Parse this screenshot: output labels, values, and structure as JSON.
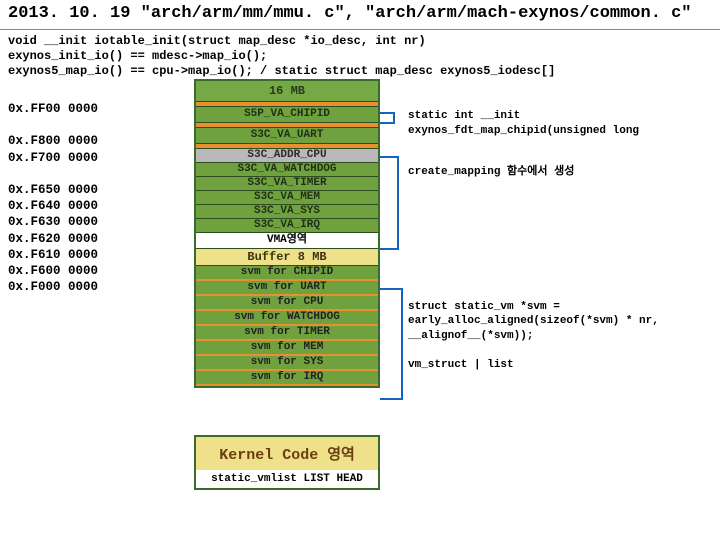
{
  "title": "2013. 10. 19 \"arch/arm/mm/mmu. c\", \"arch/arm/mach-exynos/common. c\"",
  "code": {
    "l1": "void __init iotable_init(struct map_desc *io_desc, int nr)",
    "l2": "exynos_init_io() == mdesc->map_io();",
    "l3": "exynos5_map_io() == cpu->map_io(); / static struct map_desc exynos5_iodesc[]"
  },
  "addresses": [
    "0x.FF00 0000",
    "",
    "0x.F800 0000",
    "0x.F700 0000",
    "",
    "0x.F650 0000",
    "0x.F640 0000",
    "0x.F630 0000",
    "0x.F620 0000",
    "0x.F610 0000",
    "0x.F600 0000",
    "0x.F000 0000"
  ],
  "mem": {
    "header": "16 MB",
    "rows": [
      "S5P_VA_CHIPID",
      "S3C_VA_UART",
      "S3C_ADDR_CPU",
      "S3C_VA_WATCHDOG",
      "S3C_VA_TIMER",
      "S3C_VA_MEM",
      "S3C_VA_SYS",
      "S3C_VA_IRQ"
    ],
    "vma": "VMA영역",
    "buffer": "Buffer 8 MB",
    "svm": [
      "svm for CHIPID",
      "svm for UART",
      "svm for CPU",
      "svm for WATCHDOG",
      "svm for TIMER",
      "svm for MEM",
      "svm for SYS",
      "svm for IRQ"
    ]
  },
  "kernel": {
    "title": "Kernel Code 영역",
    "sub": "static_vmlist LIST HEAD"
  },
  "notes": {
    "n1": "static int __init exynos_fdt_map_chipid(unsigned long",
    "n2": "create_mapping 함수에서 생성",
    "n3a": "struct static_vm *svm =",
    "n3b": "         early_alloc_aligned(sizeof(*svm) * nr,",
    "n3c": "                     __alignof__(*svm));",
    "n4": "vm_struct | list"
  }
}
